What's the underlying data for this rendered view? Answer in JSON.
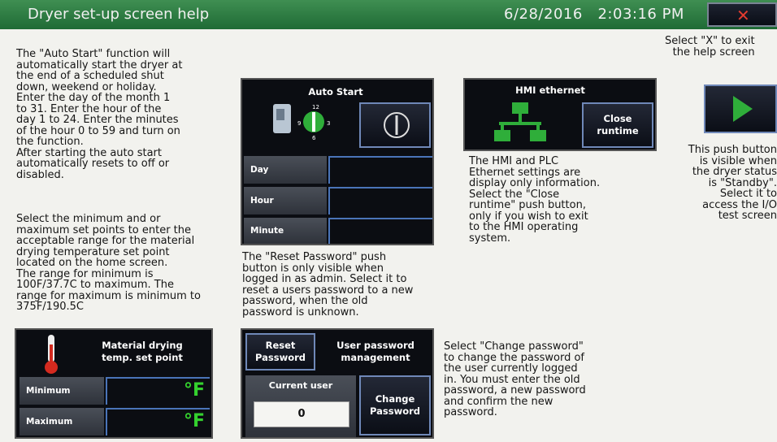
{
  "header": {
    "title": "Dryer set-up screen help",
    "date": "6/28/2016",
    "time": "2:03:16 PM",
    "close_symbol": "✕",
    "close_icon": "close-x-icon",
    "accent": "#2f7d44"
  },
  "help_texts": {
    "auto_start": "The \"Auto Start\" function will\nautomatically start the dryer at\nthe end of a scheduled shut\ndown, weekend or holiday.\nEnter the day of the month 1\nto 31. Enter the hour of the\nday 1 to 24. Enter the minutes\nof the hour 0 to 59 and turn on\nthe function.\nAfter starting the auto start\nautomatically resets to off or\ndisabled.",
    "set_points": "Select the minimum and or\nmaximum set points to enter the\nacceptable range for the material\ndrying temperature set point\nlocated on the home screen.\nThe range for minimum is\n100F/37.7C to maximum. The\nrange for maximum is minimum to\n375F/190.5C",
    "reset_password": "The \"Reset Password\" push\nbutton is only visible when\nlogged in as admin. Select it to\nreset a users password to a new\npassword, when the old\npassword is unknown.",
    "hmi_ethernet": "The HMI and PLC\nEthernet settings are\ndisplay only information.\nSelect the \"Close\nruntime\" push button,\nonly if you wish to exit\nto the HMI operating\nsystem.",
    "change_password": "Select \"Change password\"\nto change the password of\nthe user currently logged\nin. You must enter the old\npassword, a new password\nand confirm the new\npassword.",
    "exit_help": "Select \"X\" to exit\nthe help screen",
    "io_test": "This push button\nis visible when\nthe dryer status\nis \"Standby\".\nSelect it to\naccess the I/O\ntest screen"
  },
  "auto_start": {
    "title": "Auto Start",
    "rows": [
      "Day",
      "Hour",
      "Minute"
    ],
    "icons": [
      "dryer-icon",
      "dial-icon",
      "power-icon"
    ],
    "dial_numbers": [
      "12",
      "9",
      "3",
      "6"
    ]
  },
  "hmi_ethernet": {
    "title": "HMI ethernet",
    "close_runtime_label": "Close\nruntime",
    "icon": "network-icon"
  },
  "temp_panel": {
    "title": "Material drying\ntemp. set point",
    "rows": [
      "Minimum",
      "Maximum"
    ],
    "unit": "°F",
    "icon": "thermometer-icon"
  },
  "password_panel": {
    "reset_label": "Reset\nPassword",
    "title": "User password\nmanagement",
    "current_user_label": "Current user",
    "current_user_value": "0",
    "change_label": "Change\nPassword"
  },
  "io_test_button": {
    "icon": "arrow-right-icon"
  }
}
